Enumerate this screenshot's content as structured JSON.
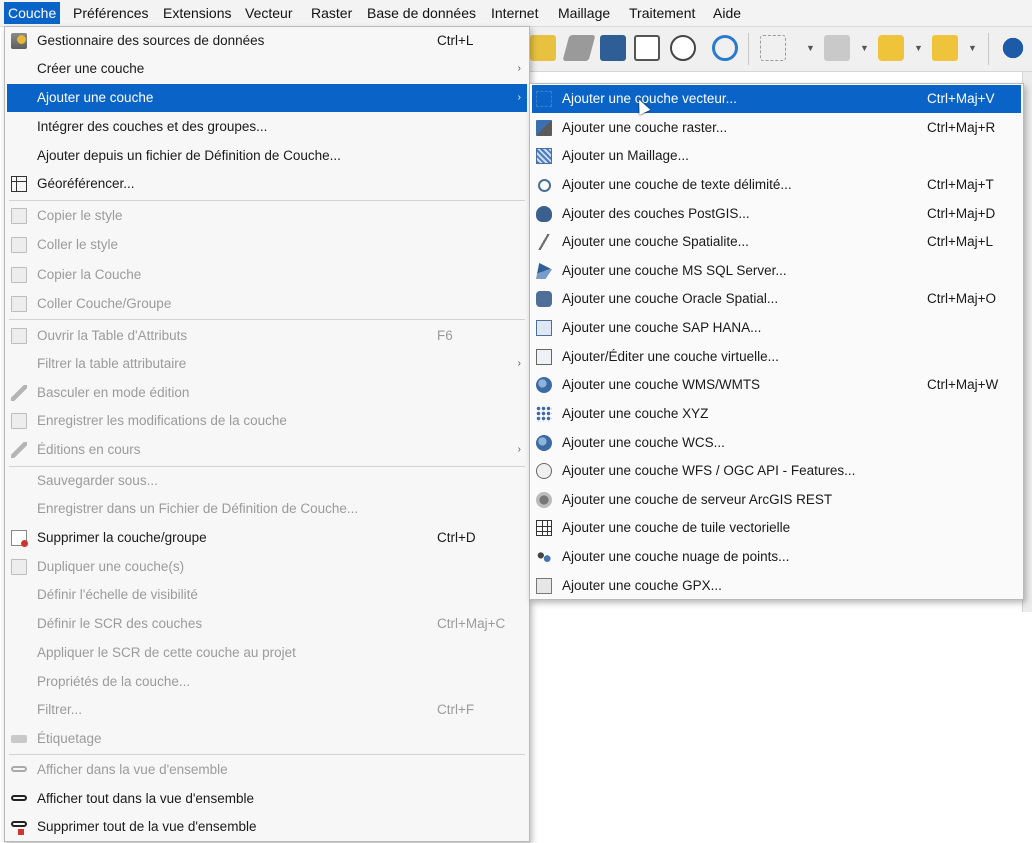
{
  "menubar": [
    {
      "label": "Couche",
      "active": true
    },
    {
      "label": "Préférences"
    },
    {
      "label": "Extensions"
    },
    {
      "label": "Vecteur"
    },
    {
      "label": "Raster"
    },
    {
      "label": "Base de données"
    },
    {
      "label": "Internet"
    },
    {
      "label": "Maillage"
    },
    {
      "label": "Traitement"
    },
    {
      "label": "Aide"
    }
  ],
  "main_menu": [
    {
      "label": "Gestionnaire des sources de données",
      "shortcut": "Ctrl+L",
      "icon": "datasource-manager-icon"
    },
    {
      "label": "Créer une couche",
      "submenu": "›"
    },
    {
      "label": "Ajouter une couche",
      "submenu": "›",
      "highlighted": true
    },
    {
      "label": "Intégrer des couches et des groupes..."
    },
    {
      "label": "Ajouter depuis un fichier de Définition de Couche..."
    },
    {
      "label": "Géoréférencer...",
      "icon": "georeferencer-icon"
    },
    {
      "label": "Copier le style",
      "disabled": true,
      "icon": "copy-style-icon"
    },
    {
      "label": "Coller le style",
      "disabled": true,
      "icon": "paste-style-icon"
    },
    {
      "label": "Copier la Couche",
      "disabled": true,
      "icon": "copy-layer-icon"
    },
    {
      "label": "Coller Couche/Groupe",
      "disabled": true,
      "icon": "paste-layer-icon"
    },
    {
      "label": "Ouvrir la Table d'Attributs",
      "shortcut": "F6",
      "disabled": true,
      "icon": "attribute-table-icon"
    },
    {
      "label": "Filtrer la table attributaire",
      "submenu": "›",
      "disabled": true
    },
    {
      "label": "Basculer en mode édition",
      "disabled": true,
      "icon": "pencil-icon"
    },
    {
      "label": "Enregistrer les modifications de la couche",
      "disabled": true,
      "icon": "save-edits-icon"
    },
    {
      "label": "Éditions en cours",
      "submenu": "›",
      "disabled": true,
      "icon": "current-edits-icon"
    },
    {
      "label": "Sauvegarder sous...",
      "disabled": true
    },
    {
      "label": "Enregistrer dans un Fichier de Définition de Couche...",
      "disabled": true
    },
    {
      "label": "Supprimer la couche/groupe",
      "shortcut": "Ctrl+D",
      "icon": "remove-layer-icon"
    },
    {
      "label": "Dupliquer une couche(s)",
      "disabled": true,
      "icon": "duplicate-layer-icon"
    },
    {
      "label": "Définir l'échelle de visibilité",
      "disabled": true
    },
    {
      "label": "Définir le SCR des couches",
      "shortcut": "Ctrl+Maj+C",
      "disabled": true
    },
    {
      "label": "Appliquer le SCR de cette couche au projet",
      "disabled": true
    },
    {
      "label": "Propriétés de la couche...",
      "disabled": true
    },
    {
      "label": "Filtrer...",
      "shortcut": "Ctrl+F",
      "disabled": true
    },
    {
      "label": "Étiquetage",
      "disabled": true,
      "icon": "labeling-icon"
    },
    {
      "label": "Afficher dans la vue d'ensemble",
      "disabled": true,
      "icon": "overview-icon"
    },
    {
      "label": "Afficher tout dans la vue d'ensemble",
      "icon": "overview-all-icon"
    },
    {
      "label": "Supprimer tout de la vue d'ensemble",
      "icon": "overview-remove-icon"
    }
  ],
  "sub_menu": [
    {
      "label": "Ajouter une couche vecteur...",
      "shortcut": "Ctrl+Maj+V",
      "highlighted": true,
      "icon": "vector-layer-icon"
    },
    {
      "label": "Ajouter une couche raster...",
      "shortcut": "Ctrl+Maj+R",
      "icon": "raster-layer-icon"
    },
    {
      "label": "Ajouter un Maillage...",
      "icon": "mesh-layer-icon"
    },
    {
      "label": "Ajouter une couche de texte délimité...",
      "shortcut": "Ctrl+Maj+T",
      "icon": "delimited-text-icon"
    },
    {
      "label": "Ajouter des couches PostGIS...",
      "shortcut": "Ctrl+Maj+D",
      "icon": "postgis-icon"
    },
    {
      "label": "Ajouter une couche Spatialite...",
      "shortcut": "Ctrl+Maj+L",
      "icon": "spatialite-icon"
    },
    {
      "label": "Ajouter une couche MS SQL Server...",
      "icon": "mssql-icon"
    },
    {
      "label": "Ajouter une couche Oracle Spatial...",
      "shortcut": "Ctrl+Maj+O",
      "icon": "oracle-icon"
    },
    {
      "label": "Ajouter une couche SAP HANA...",
      "icon": "hana-icon"
    },
    {
      "label": "Ajouter/Éditer une couche virtuelle...",
      "icon": "virtual-layer-icon"
    },
    {
      "label": "Ajouter une couche WMS/WMTS",
      "shortcut": "Ctrl+Maj+W",
      "icon": "wms-icon"
    },
    {
      "label": "Ajouter une couche XYZ",
      "icon": "xyz-icon"
    },
    {
      "label": "Ajouter une couche WCS...",
      "icon": "wcs-icon"
    },
    {
      "label": "Ajouter une couche WFS / OGC API - Features...",
      "icon": "wfs-icon"
    },
    {
      "label": "Ajouter une couche de serveur ArcGIS REST",
      "icon": "arcgis-icon"
    },
    {
      "label": "Ajouter une couche de tuile vectorielle",
      "icon": "vector-tile-icon"
    },
    {
      "label": "Ajouter une couche nuage de points...",
      "icon": "point-cloud-icon"
    },
    {
      "label": "Ajouter une couche GPX...",
      "icon": "gpx-icon"
    }
  ],
  "colors": {
    "highlight": "#0a64c8",
    "disabled_text": "#9b9b9b"
  }
}
